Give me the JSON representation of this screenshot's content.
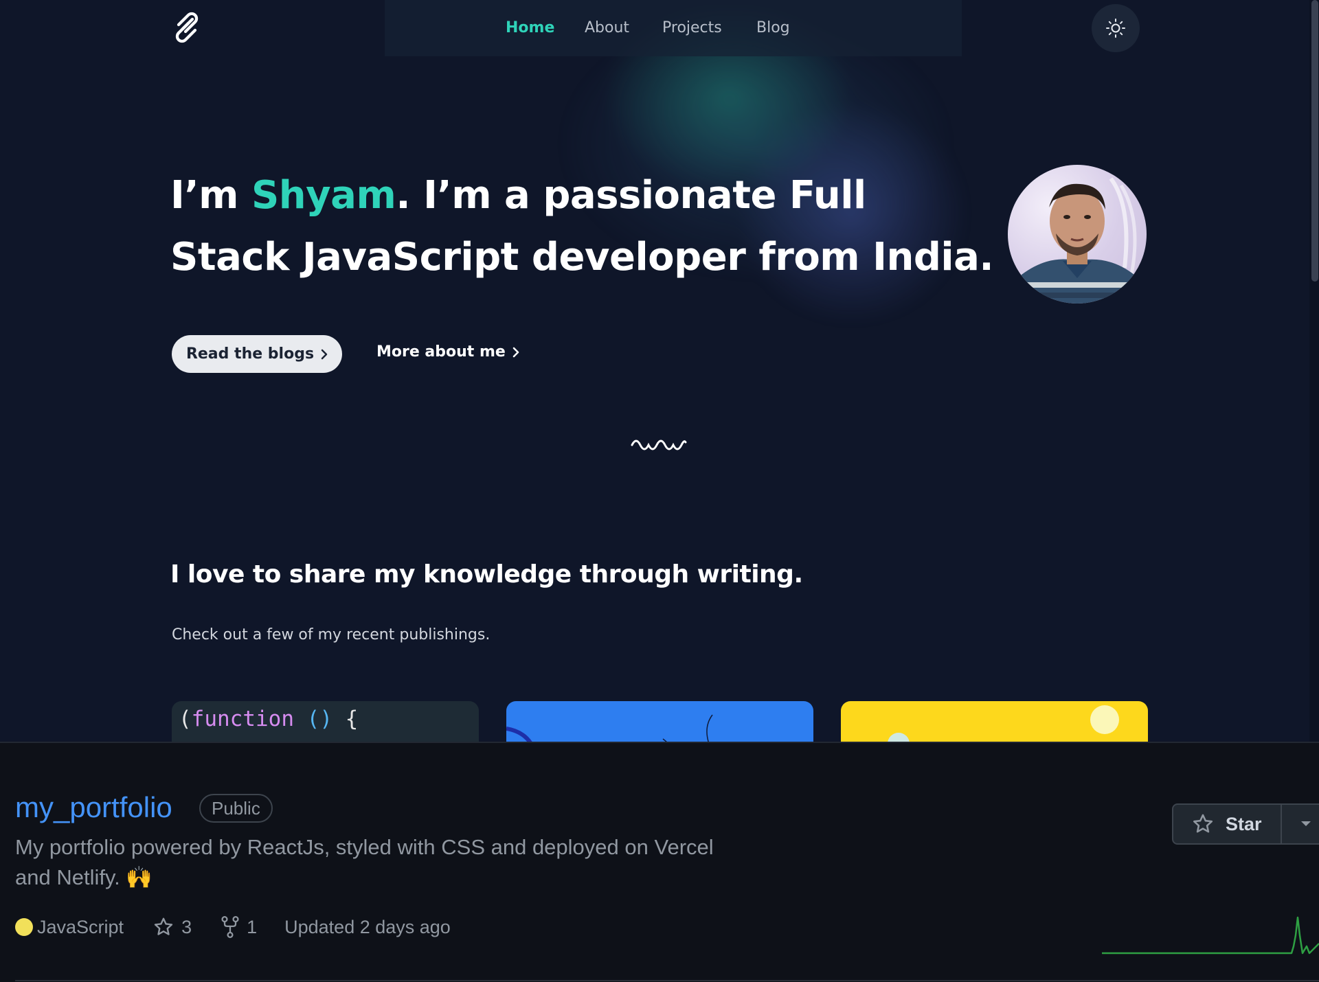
{
  "nav": {
    "links": [
      "Home",
      "About",
      "Projects",
      "Blog"
    ],
    "active": "Home",
    "logo_icon": "logo-mark-icon",
    "theme_icon": "sun-icon"
  },
  "hero": {
    "title_prefix": "I’m ",
    "title_name": "Shyam",
    "title_suffix": ". I’m a passionate Full Stack JavaScript developer from India.",
    "primary_button": "Read the blogs",
    "secondary_button": "More about me",
    "divider_icon": "squiggle-icon"
  },
  "writing": {
    "heading": "I love to share my knowledge through writing.",
    "subheading": "Check out a few of my recent publishings.",
    "card1_code": {
      "open_paren": "(",
      "keyword": "function",
      "parens": "()",
      "brace": "{"
    }
  },
  "repo": {
    "name": "my_portfolio",
    "visibility": "Public",
    "description": "My portfolio powered by ReactJs, styled with CSS and deployed on Vercel and Netlify. 🙌",
    "language": "JavaScript",
    "language_color": "#f1e05a",
    "stars": "3",
    "forks": "1",
    "updated": "Updated 2 days ago",
    "star_button": "Star"
  },
  "colors": {
    "accent": "#2fd3b9",
    "background": "#0f1629",
    "repo_link": "#4493f8"
  }
}
